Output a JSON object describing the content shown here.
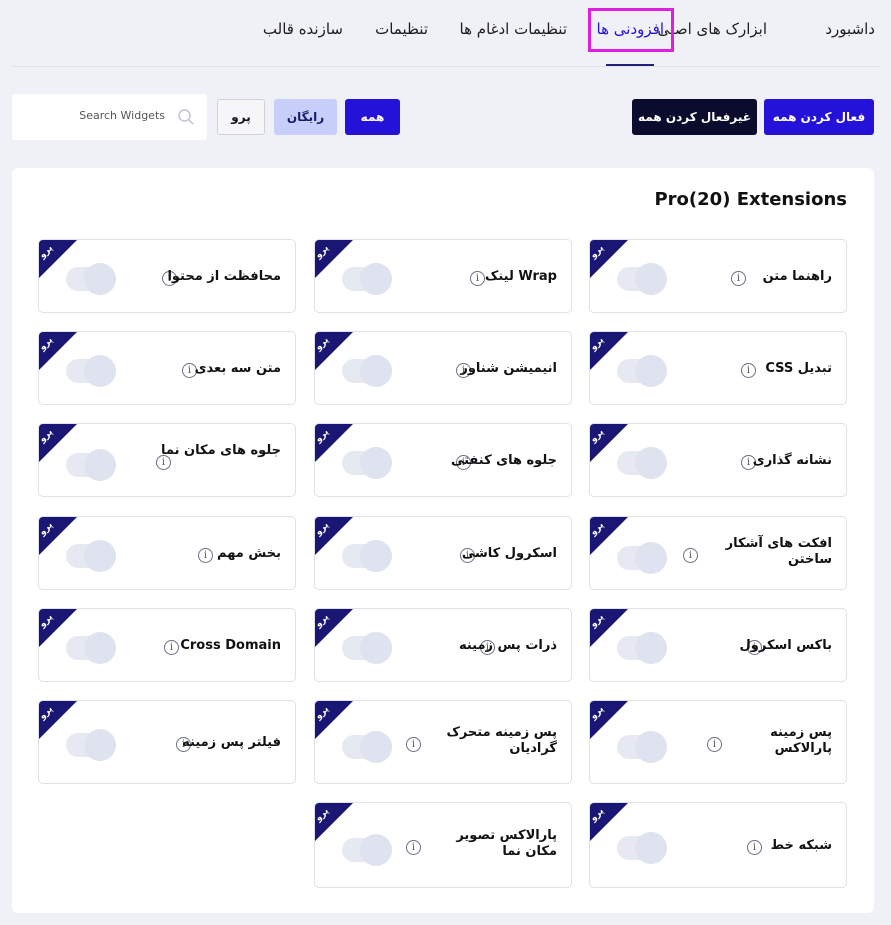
{
  "tabs": [
    {
      "label": "داشبورد"
    },
    {
      "label": "ابزارک های اصلی"
    },
    {
      "label": "افزودنی ها"
    },
    {
      "label": "تنظیمات ادغام ها"
    },
    {
      "label": "تنظیمات"
    },
    {
      "label": "سازنده قالب"
    }
  ],
  "toolbar": {
    "activate_all": "فعال کردن همه",
    "deactivate_all": "غیرفعال کردن همه",
    "filter_all": "همه",
    "filter_free": "رایگان",
    "filter_pro": "پرو",
    "search_placeholder": "Search Widgets"
  },
  "section": {
    "title": "Pro(20) Extensions"
  },
  "ribbon_label": "پرو",
  "cards": [
    {
      "label": "راهنما متن"
    },
    {
      "label": "Wrap لینک"
    },
    {
      "label": "محافظت از محتوا"
    },
    {
      "label": "تبدیل CSS"
    },
    {
      "label": "انیمیشن شناور"
    },
    {
      "label": "متن سه بعدی"
    },
    {
      "label": "نشانه گذاری"
    },
    {
      "label": "جلوه های کنفتی"
    },
    {
      "label": "جلوه های مکان نما"
    },
    {
      "label": "افکت های آشکار ساختن"
    },
    {
      "label": "اسکرول کاشی"
    },
    {
      "label": "بخش مهم"
    },
    {
      "label": "باکس اسکرول"
    },
    {
      "label": "ذرات پس زمینه"
    },
    {
      "label": "Cross Domain"
    },
    {
      "label": "پس زمینه پارالاکس"
    },
    {
      "label": "پس زمینه متحرک گرادیان"
    },
    {
      "label": "فیلتر پس زمینه"
    },
    {
      "label": "شبکه خط"
    },
    {
      "label": "پارالاکس تصویر مکان نما"
    }
  ],
  "colors": {
    "primary": "#2512d8",
    "dark": "#0b0b2e",
    "ribbon": "#1a1674",
    "active_tab_highlight": "#e01ee0"
  }
}
